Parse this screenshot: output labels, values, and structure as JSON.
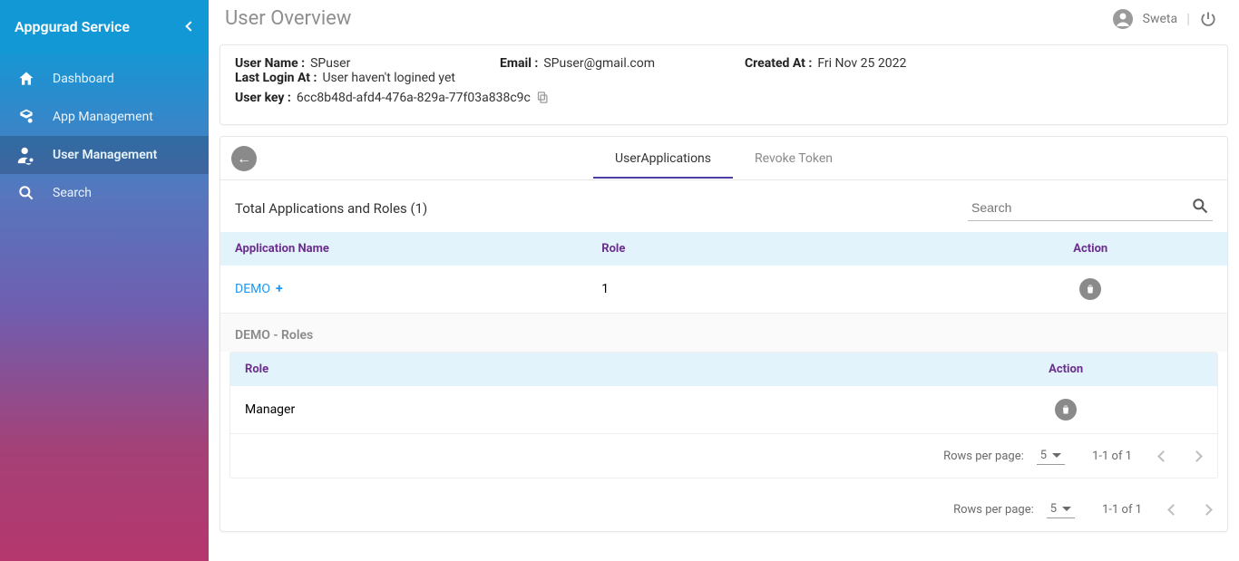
{
  "sidebar": {
    "title": "Appgurad Service",
    "items": [
      {
        "label": "Dashboard"
      },
      {
        "label": "App Management"
      },
      {
        "label": "User Management"
      },
      {
        "label": "Search"
      }
    ]
  },
  "topbar": {
    "page_title": "User Overview",
    "user_name": "Sweta"
  },
  "user_info": {
    "user_name_label": "User Name :",
    "user_name_value": "SPuser",
    "email_label": "Email :",
    "email_value": "SPuser@gmail.com",
    "created_at_label": "Created At :",
    "created_at_value": "Fri Nov 25 2022",
    "last_login_label": "Last Login At :",
    "last_login_value": "User haven't logined yet",
    "user_key_label": "User key :",
    "user_key_value": "6cc8b48d-afd4-476a-829a-77f03a838c9c"
  },
  "tabs": {
    "user_applications": "UserApplications",
    "revoke_token": "Revoke Token"
  },
  "section": {
    "title": "Total Applications and Roles (1)",
    "search_placeholder": "Search"
  },
  "table": {
    "headers": {
      "app": "Application Name",
      "role": "Role",
      "action": "Action"
    },
    "rows": [
      {
        "app": "DEMO",
        "role": "1"
      }
    ]
  },
  "sub": {
    "title": "DEMO - Roles",
    "headers": {
      "role": "Role",
      "action": "Action"
    },
    "rows": [
      {
        "role": "Manager"
      }
    ]
  },
  "pagination_inner": {
    "rpp_label": "Rows per page:",
    "rpp_value": "5",
    "range": "1-1 of 1"
  },
  "pagination_outer": {
    "rpp_label": "Rows per page:",
    "rpp_value": "5",
    "range": "1-1 of 1"
  }
}
